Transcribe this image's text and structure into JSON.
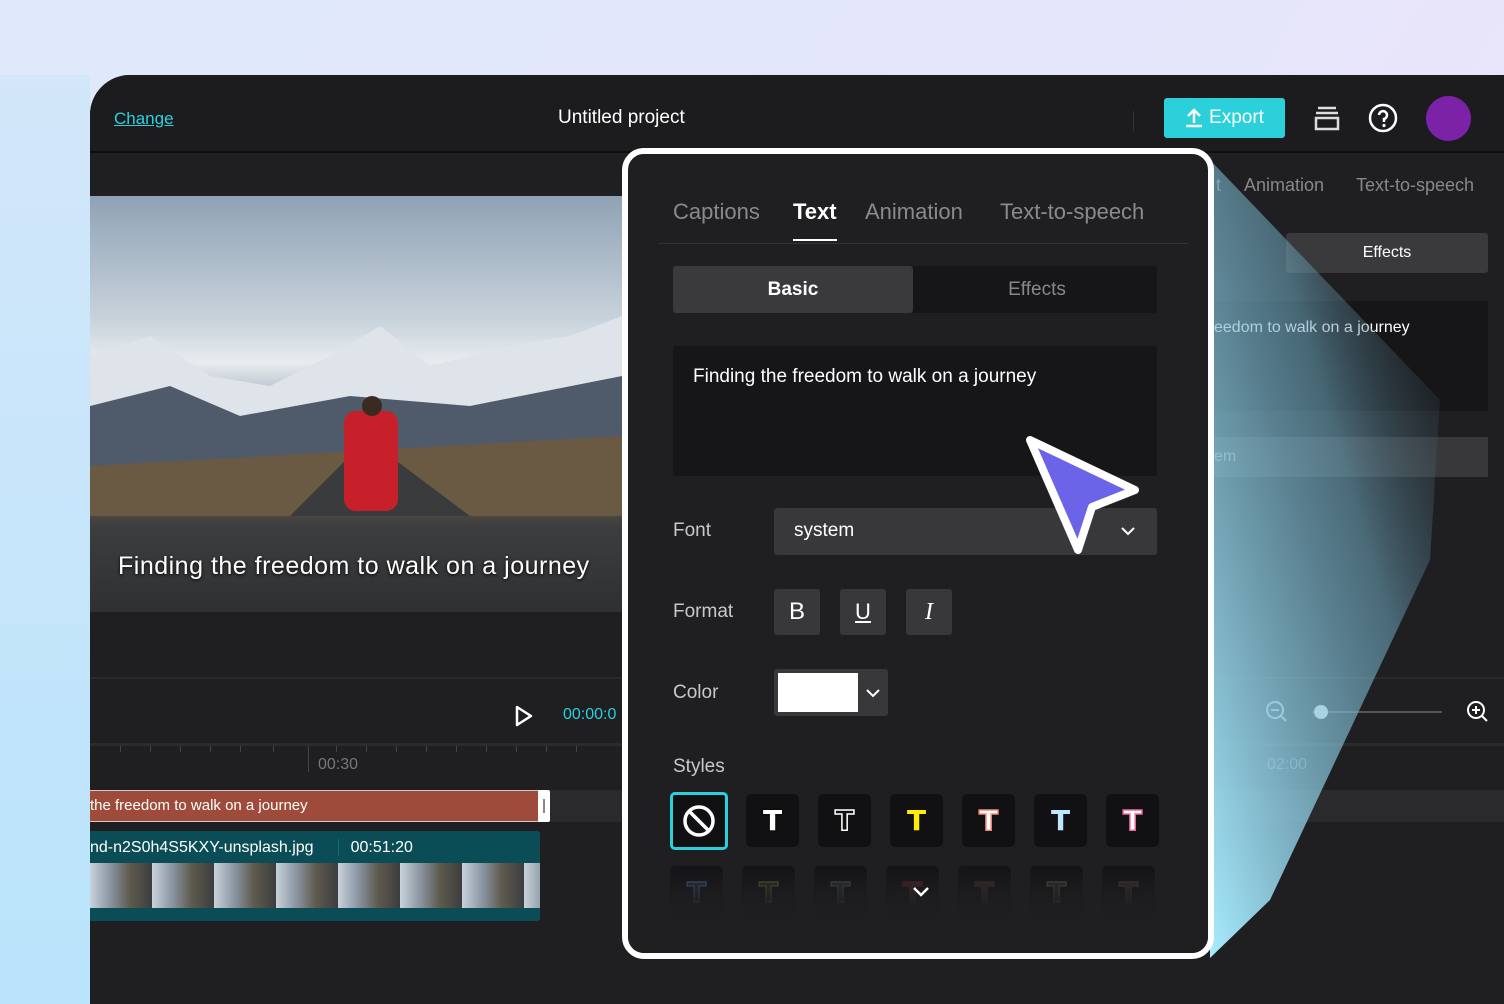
{
  "header": {
    "change_link": "Change",
    "project_title": "Untitled project",
    "export_label": "Export",
    "avatar_color": "#7b22a6"
  },
  "preview": {
    "caption": "Finding the freedom to walk on a journey"
  },
  "player": {
    "current_time": "00:00:0"
  },
  "timeline": {
    "ruler": [
      "00:30",
      "02:00"
    ],
    "caption_clip": "the freedom to walk on a journey",
    "video_clip": {
      "filename": "nd-n2S0h4S5KXY-unsplash.jpg",
      "duration": "00:51:20"
    },
    "zoom_level": 0.05
  },
  "background_panel": {
    "tabs": [
      "t",
      "Animation",
      "Text-to-speech"
    ],
    "effects": "Effects",
    "text": "eedom to walk on a journey",
    "font": "em"
  },
  "panel": {
    "tabs": [
      {
        "label": "Captions"
      },
      {
        "label": "Text",
        "active": true
      },
      {
        "label": "Animation"
      },
      {
        "label": "Text-to-speech"
      }
    ],
    "segments": {
      "basic": "Basic",
      "effects": "Effects"
    },
    "text_value": "Finding the freedom to walk on a journey",
    "font_label": "Font",
    "font_value": "system",
    "format_label": "Format",
    "format_buttons": [
      "B",
      "U",
      "I"
    ],
    "color_label": "Color",
    "color_value": "#ffffff",
    "styles_label": "Styles",
    "styles": [
      {
        "name": "none",
        "glyph": "⃠"
      },
      {
        "name": "white-black-outline",
        "glyph": "T",
        "color": "#ffffff"
      },
      {
        "name": "outline-white",
        "glyph": "T",
        "color": "#111113"
      },
      {
        "name": "yellow",
        "glyph": "T",
        "color": "#ffee00"
      },
      {
        "name": "salmon",
        "glyph": "T",
        "color": "#f5a08e"
      },
      {
        "name": "light-blue",
        "glyph": "T",
        "color": "#bfe6ff"
      },
      {
        "name": "pink",
        "glyph": "T",
        "color": "#f06aa0"
      }
    ],
    "styles_row2": [
      "#3b6ea8",
      "#6a6a22",
      "#4a5a6a",
      "#7a1a22",
      "#5a2a22",
      "#5a5a4a",
      "#5a3a3a"
    ]
  },
  "accent": "#2bd0dc",
  "cursor_color": "#6b63e8"
}
